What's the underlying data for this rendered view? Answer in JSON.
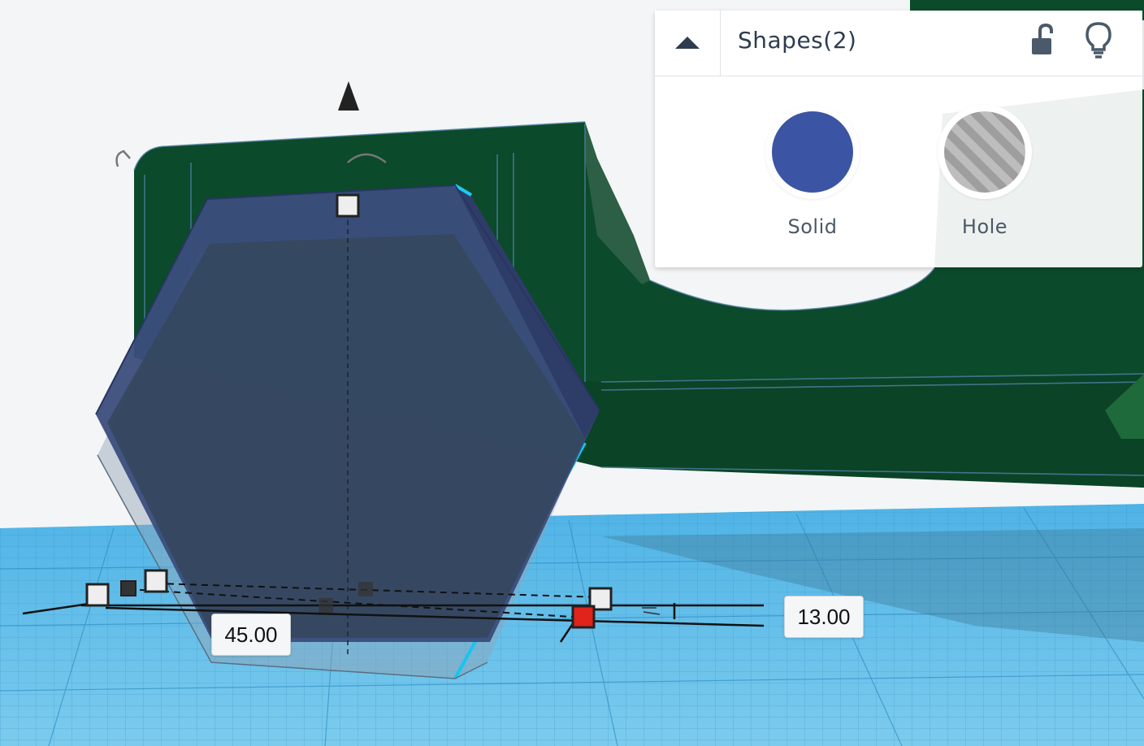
{
  "inspector": {
    "title": "Shapes(2)",
    "solid": {
      "label": "Solid",
      "color": "#3b54a3"
    },
    "hole": {
      "label": "Hole"
    }
  },
  "dimensions": {
    "width": "45.00",
    "depth": "13.00"
  },
  "colors": {
    "workplane": "#6fc1e8",
    "model_green": "#0b4a2a",
    "hexagon": "#3a4a78",
    "active_handle": "#e0231b"
  }
}
